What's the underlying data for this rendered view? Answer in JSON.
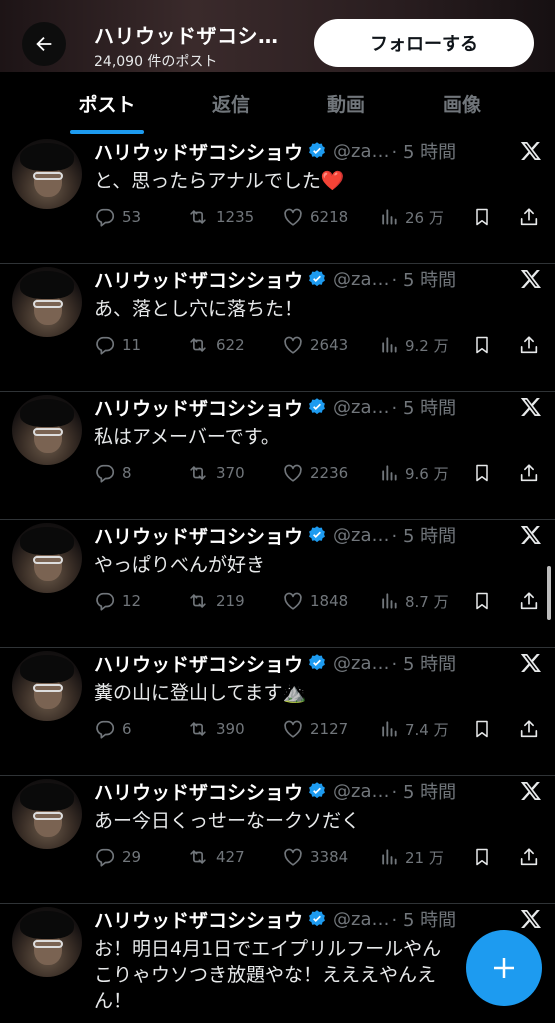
{
  "header": {
    "title": "ハリウッドザコシ…",
    "post_count": "24,090 件のポスト",
    "follow_label": "フォローする"
  },
  "tabs": [
    {
      "label": "ポスト",
      "active": true
    },
    {
      "label": "返信",
      "active": false
    },
    {
      "label": "動画",
      "active": false
    },
    {
      "label": "画像",
      "active": false
    }
  ],
  "posts": [
    {
      "name": "ハリウッドザコシショウ",
      "handle": "@za…",
      "time": "· 5 時間",
      "text": "と、思ったらアナルでした❤️",
      "replies": "53",
      "reposts": "1235",
      "likes": "6218",
      "views": "26 万"
    },
    {
      "name": "ハリウッドザコシショウ",
      "handle": "@za…",
      "time": "· 5 時間",
      "text": "あ、落とし穴に落ちた！",
      "replies": "11",
      "reposts": "622",
      "likes": "2643",
      "views": "9.2 万"
    },
    {
      "name": "ハリウッドザコシショウ",
      "handle": "@za…",
      "time": "· 5 時間",
      "text": "私はアメーバーです。",
      "replies": "8",
      "reposts": "370",
      "likes": "2236",
      "views": "9.6 万"
    },
    {
      "name": "ハリウッドザコシショウ",
      "handle": "@za…",
      "time": "· 5 時間",
      "text": "やっぱりべんが好き",
      "replies": "12",
      "reposts": "219",
      "likes": "1848",
      "views": "8.7 万"
    },
    {
      "name": "ハリウッドザコシショウ",
      "handle": "@za…",
      "time": "· 5 時間",
      "text": "糞の山に登山してます⛰️",
      "replies": "6",
      "reposts": "390",
      "likes": "2127",
      "views": "7.4 万"
    },
    {
      "name": "ハリウッドザコシショウ",
      "handle": "@za…",
      "time": "· 5 時間",
      "text": "あー今日くっせーなークソだく",
      "replies": "29",
      "reposts": "427",
      "likes": "3384",
      "views": "21 万"
    },
    {
      "name": "ハリウッドザコシショウ",
      "handle": "@za…",
      "time": "· 5 時間",
      "text": "お！明日4月1日でエイプリルフールやん\nこりゃウソつき放題やな！えええやんえ\nん！",
      "replies": "",
      "reposts": "",
      "likes": "",
      "views": ""
    }
  ],
  "icons": {
    "back": "arrow-left-icon",
    "verified": "verified-badge-icon",
    "x": "x-logo-icon",
    "reply": "reply-icon",
    "repost": "repost-icon",
    "like": "heart-icon",
    "views": "views-chart-icon",
    "bookmark": "bookmark-icon",
    "share": "share-icon",
    "compose": "plus-icon"
  },
  "colors": {
    "accent": "#1d9bf0",
    "muted": "#71767b",
    "background": "#000000"
  }
}
